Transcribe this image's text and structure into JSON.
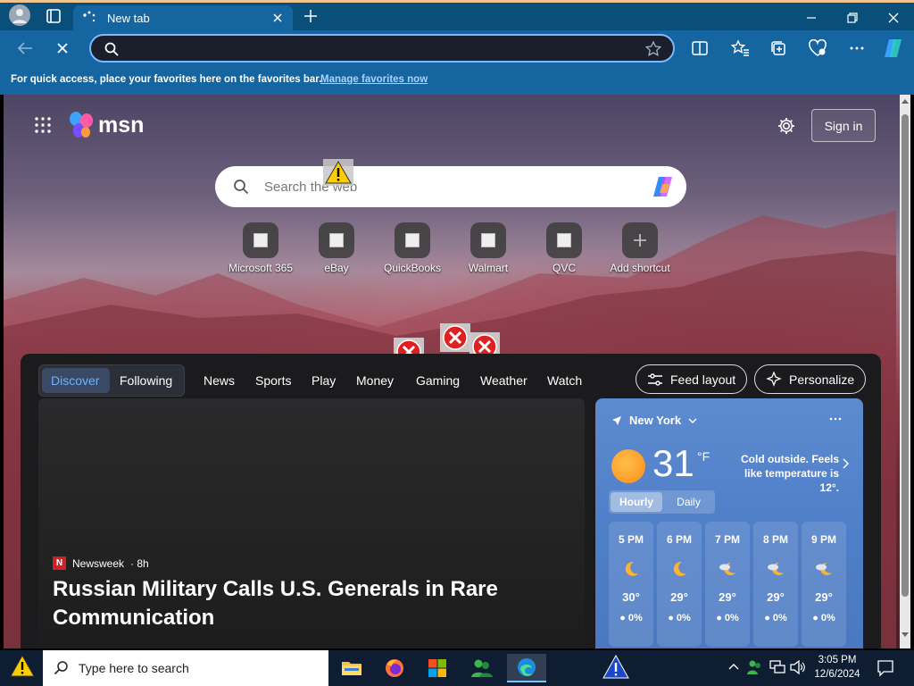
{
  "browser": {
    "tab_title": "New tab",
    "favorites_bar": {
      "message": "For quick access, place your favorites here on the favorites bar.",
      "manage_link": "Manage favorites now"
    }
  },
  "msn": {
    "brand": "msn",
    "sign_in": "Sign in",
    "search_placeholder": "Search the web",
    "shortcuts": [
      {
        "label": "Microsoft 365"
      },
      {
        "label": "eBay"
      },
      {
        "label": "QuickBooks"
      },
      {
        "label": "Walmart"
      },
      {
        "label": "QVC"
      },
      {
        "label": "Add shortcut"
      }
    ],
    "feed_tabs": [
      "Discover",
      "Following"
    ],
    "nav": [
      "News",
      "Sports",
      "Play",
      "Money",
      "Gaming",
      "Weather",
      "Watch"
    ],
    "feed_layout": "Feed layout",
    "personalize": "Personalize",
    "hero": {
      "source": "Newsweek",
      "source_logo": "N",
      "age": "· 8h",
      "headline": "Russian Military Calls U.S. Generals in Rare Communication"
    },
    "weather": {
      "location": "New York",
      "temp": "31",
      "unit": "°F",
      "note": "Cold outside. Feels like temperature is 12°.",
      "tabs": [
        "Hourly",
        "Daily"
      ],
      "hours": [
        {
          "time": "5 PM",
          "temp": "30°",
          "precip": "0%",
          "icon": "moon-icon"
        },
        {
          "time": "6 PM",
          "temp": "29°",
          "precip": "0%",
          "icon": "moon-icon"
        },
        {
          "time": "7 PM",
          "temp": "29°",
          "precip": "0%",
          "icon": "partly-cloudy-night-icon"
        },
        {
          "time": "8 PM",
          "temp": "29°",
          "precip": "0%",
          "icon": "partly-cloudy-night-icon"
        },
        {
          "time": "9 PM",
          "temp": "29°",
          "precip": "0%",
          "icon": "partly-cloudy-night-icon"
        }
      ]
    }
  },
  "taskbar": {
    "search_placeholder": "Type here to search",
    "time": "3:05 PM",
    "date": "12/6/2024"
  },
  "colors": {
    "browser_frame": "#1565a0",
    "accent_link": "#a9d3ff",
    "feed_bg": "#1b1b1d",
    "weather_bg": "#5d8bd0",
    "taskbar_bg": "#0f1d33"
  }
}
